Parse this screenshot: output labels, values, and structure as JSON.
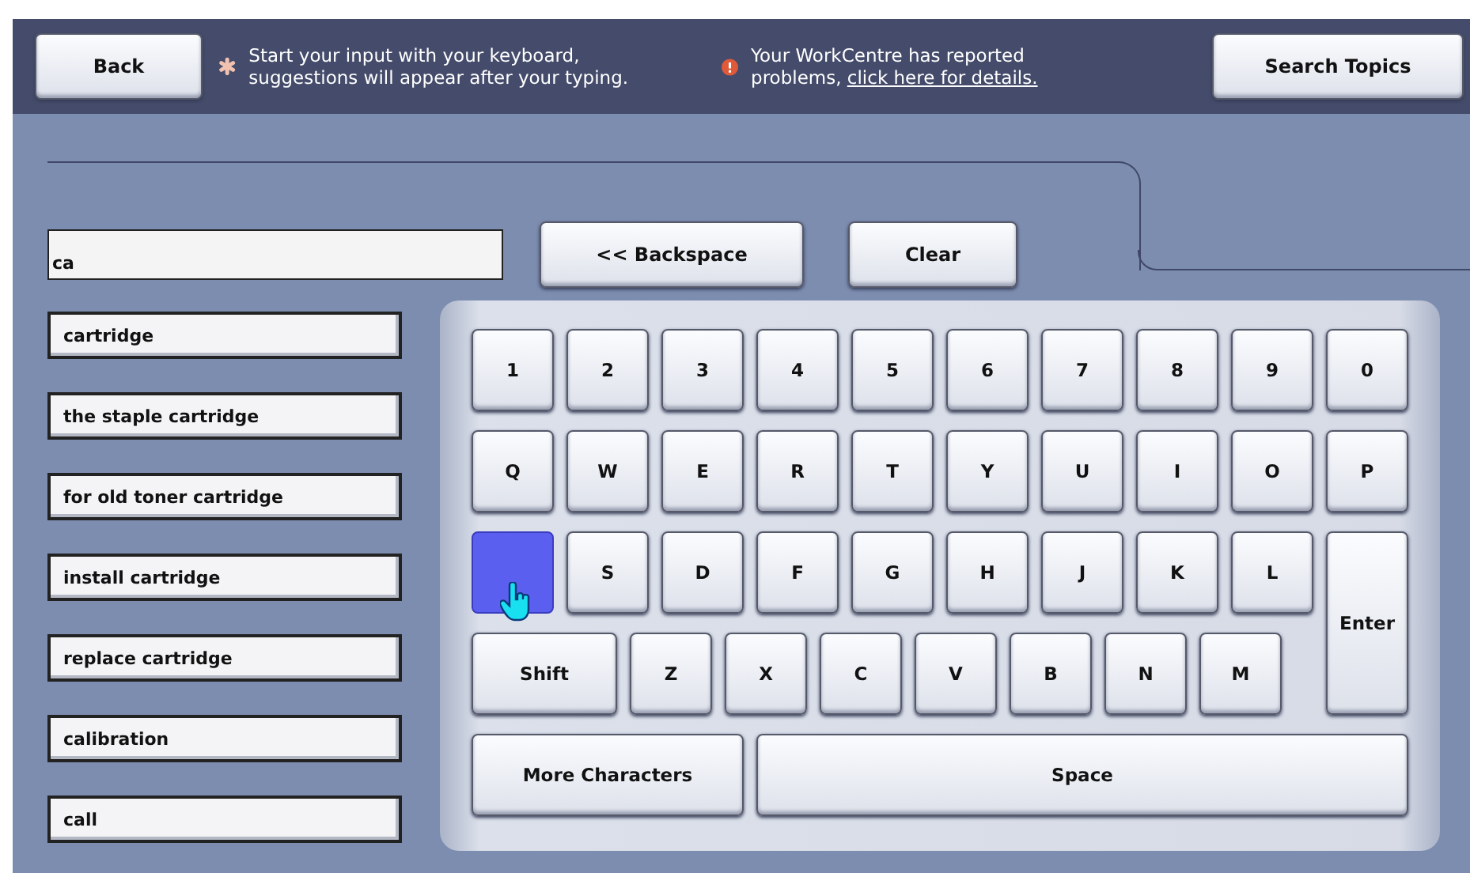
{
  "top_bar": {
    "back": "Back",
    "hint": "Start your input with your keyboard, suggestions will appear after your typing.",
    "alert": {
      "text": "Your WorkCentre has reported problems,",
      "link": "click here for details."
    },
    "search_topics": "Search Topics"
  },
  "search": {
    "value": "ca"
  },
  "actions": [
    "<< Backspace",
    "Clear"
  ],
  "suggestions": [
    "cartridge",
    "the staple cartridge",
    "for old toner cartridge",
    "install cartridge",
    "replace cartridge",
    "calibration",
    "call"
  ],
  "keys": [
    {
      "kind": "key",
      "label": "1",
      "pressed": false
    },
    {
      "kind": "key",
      "label": "2",
      "pressed": false
    },
    {
      "kind": "key",
      "label": "3",
      "pressed": false
    },
    {
      "kind": "key",
      "label": "4",
      "pressed": false
    },
    {
      "kind": "key",
      "label": "5",
      "pressed": false
    },
    {
      "kind": "key",
      "label": "6",
      "pressed": false
    },
    {
      "kind": "key",
      "label": "7",
      "pressed": false
    },
    {
      "kind": "key",
      "label": "8",
      "pressed": false
    },
    {
      "kind": "key",
      "label": "9",
      "pressed": false
    },
    {
      "kind": "key",
      "label": "0",
      "pressed": false
    },
    {
      "kind": "key",
      "label": "Q",
      "pressed": false
    },
    {
      "kind": "key",
      "label": "W",
      "pressed": false
    },
    {
      "kind": "key",
      "label": "E",
      "pressed": false
    },
    {
      "kind": "key",
      "label": "R",
      "pressed": false
    },
    {
      "kind": "key",
      "label": "T",
      "pressed": false
    },
    {
      "kind": "key",
      "label": "Y",
      "pressed": false
    },
    {
      "kind": "key",
      "label": "U",
      "pressed": false
    },
    {
      "kind": "key",
      "label": "I",
      "pressed": false
    },
    {
      "kind": "key",
      "label": "O",
      "pressed": false
    },
    {
      "kind": "key",
      "label": "P",
      "pressed": false
    },
    {
      "kind": "key",
      "pressed": true
    },
    {
      "kind": "key",
      "label": "S",
      "pressed": false
    },
    {
      "kind": "key",
      "label": "D",
      "pressed": false
    },
    {
      "kind": "key",
      "label": "F",
      "pressed": false
    },
    {
      "kind": "key",
      "label": "G",
      "pressed": false
    },
    {
      "kind": "key",
      "label": "H",
      "pressed": false
    },
    {
      "kind": "key",
      "label": "J",
      "pressed": false
    },
    {
      "kind": "key",
      "label": "K",
      "pressed": false
    },
    {
      "kind": "key",
      "label": "L",
      "pressed": false
    },
    {
      "kind": "enter",
      "label": "Enter",
      "pressed": false
    },
    {
      "kind": "shift",
      "label": "Shift",
      "pressed": false
    },
    {
      "kind": "key",
      "label": "Z",
      "pressed": false
    },
    {
      "kind": "key",
      "label": "X",
      "pressed": false
    },
    {
      "kind": "key",
      "label": "C",
      "pressed": false
    },
    {
      "kind": "key",
      "label": "V",
      "pressed": false
    },
    {
      "kind": "key",
      "label": "B",
      "pressed": false
    },
    {
      "kind": "key",
      "label": "N",
      "pressed": false
    },
    {
      "kind": "key",
      "label": "M",
      "pressed": false
    },
    {
      "kind": "more",
      "label": "More Characters",
      "pressed": false
    },
    {
      "kind": "space",
      "label": "Space",
      "pressed": false
    }
  ]
}
